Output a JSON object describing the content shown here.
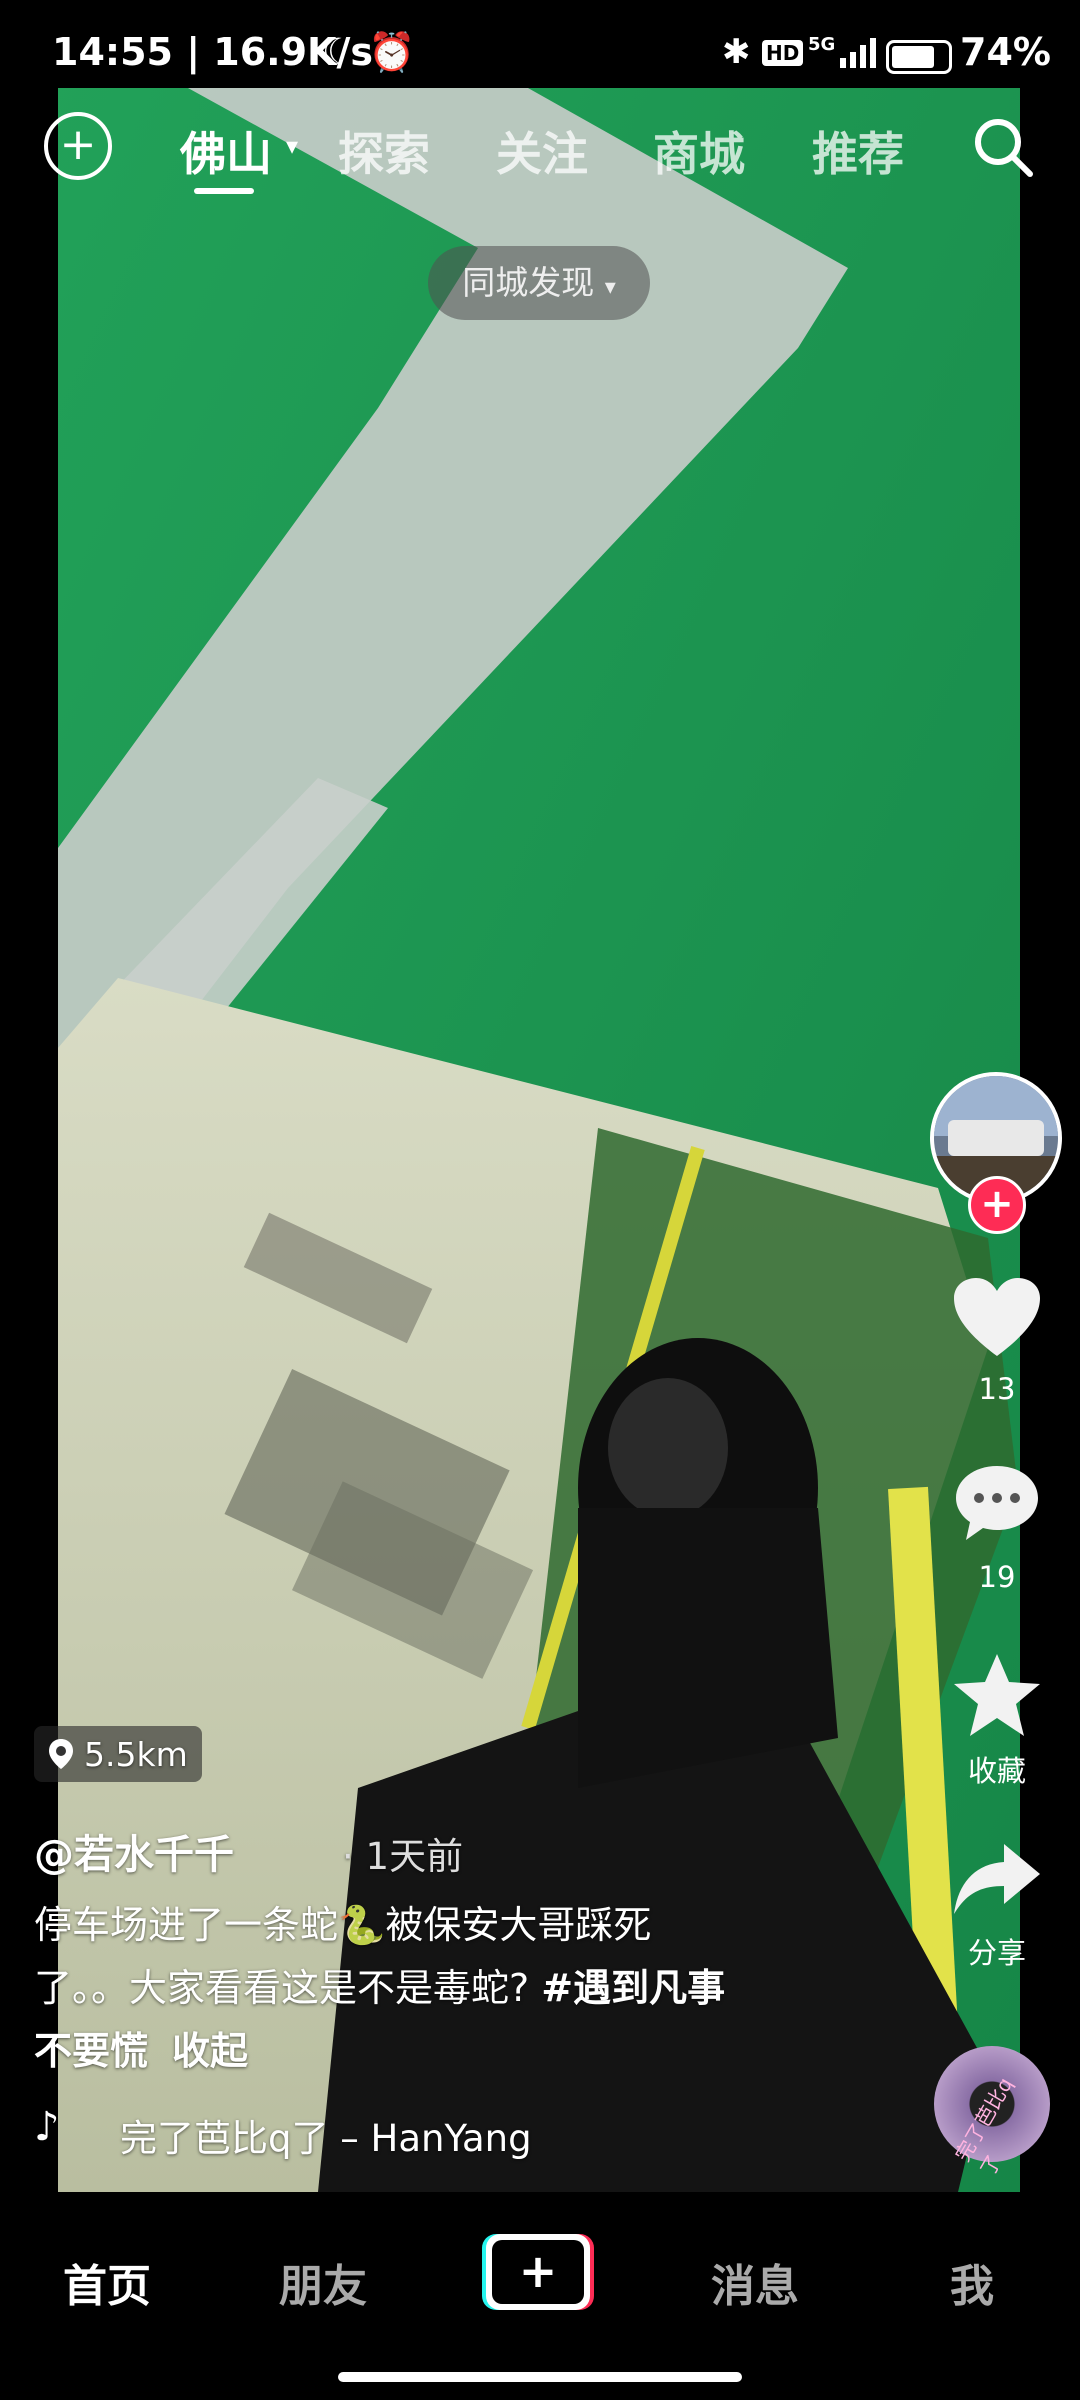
{
  "status": {
    "time_speed": "14:55 | 16.9K/s",
    "network": "5G",
    "hd": "HD",
    "battery": "74%"
  },
  "top_nav": {
    "city": "佛山",
    "tabs": [
      "探索",
      "关注",
      "商城",
      "推荐"
    ]
  },
  "pill": {
    "label": "同城发现"
  },
  "side": {
    "likes": "13",
    "comments": "19",
    "favorite_label": "收藏",
    "share_label": "分享"
  },
  "post": {
    "distance": "5.5km",
    "author": "@若水千千",
    "time": "· 1天前",
    "caption_line1": "停车场进了一条蛇🐍被保安大哥踩死",
    "caption_line2_text": "了。。大家看看这是不是毒蛇? ",
    "caption_hashtag_part1": "#遇到凡事",
    "caption_hashtag_part2": "不要慌",
    "collapse_label": "收起",
    "music": "完了芭比q了 – HanYang",
    "disc_text": "完了芭比q了"
  },
  "bottom_tabs": {
    "home": "首页",
    "friends": "朋友",
    "messages": "消息",
    "me": "我"
  }
}
